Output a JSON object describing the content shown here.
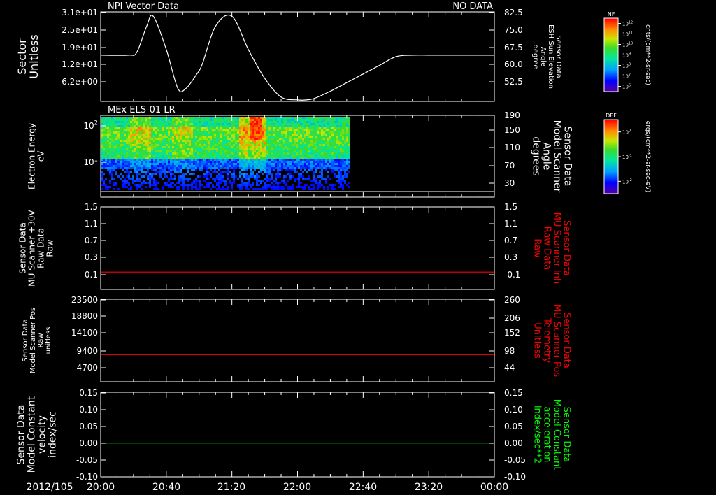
{
  "date_label": "2012/105",
  "time_ticks": [
    "20:00",
    "20:40",
    "21:20",
    "22:00",
    "22:40",
    "23:20",
    "00:00"
  ],
  "colorbars": [
    {
      "title": "NF",
      "unit": "cnts/(cm**2-sr-sec)",
      "ticks": [
        "10^12",
        "10^11",
        "10^10",
        "10^9",
        "10^8",
        "10^7",
        "10^6"
      ]
    },
    {
      "title": "DEF",
      "unit": "ergs/(cm**2-sr-sec-eV)",
      "ticks": [
        "10^0",
        "10^-1",
        "10^-2"
      ]
    }
  ],
  "chart_data": [
    {
      "type": "line",
      "title": "NPI Vector Data",
      "status": "NO DATA",
      "ylabel": [
        "Sector",
        "Unitless"
      ],
      "ylabel_right": [
        "Sensor Data",
        "ESH Sun Elevation",
        "Angle",
        "degree"
      ],
      "yticks": [
        "3.1e+01",
        "2.5e+01",
        "1.9e+01",
        "1.2e+01",
        "6.2e+00"
      ],
      "yticks_right": [
        "82.5",
        "75.0",
        "67.5",
        "60.0",
        "52.5"
      ],
      "ylim": [
        0,
        31
      ],
      "line_color": "#ffffff",
      "series": [
        {
          "x_minutes": [
            0,
            17,
            22,
            28,
            32,
            40,
            47,
            52,
            58,
            62,
            70,
            80,
            90,
            100,
            110,
            120,
            125,
            130,
            140,
            150,
            160,
            170,
            180,
            190,
            200,
            210,
            220,
            230,
            240
          ],
          "values": [
            16,
            16,
            17,
            26,
            29.5,
            18,
            4.5,
            4.5,
            9,
            13,
            26,
            29.5,
            18,
            8,
            1.5,
            0.5,
            0.5,
            1.0,
            3.5,
            6.5,
            9.5,
            12.5,
            15.5,
            16,
            16,
            16,
            16,
            16,
            16
          ]
        }
      ]
    },
    {
      "type": "heatmap",
      "title": "MEx ELS-01 LR",
      "ylabel": [
        "Electron Energy",
        "eV"
      ],
      "ylabel_right": [
        "Sensor Data",
        "Model Scanner",
        "Angle",
        "degrees"
      ],
      "yticks": [
        "10^2",
        "10^1"
      ],
      "yticks_right": [
        "190",
        "150",
        "110",
        "70",
        "30"
      ],
      "data_extent_minutes": [
        0,
        152
      ],
      "colormap": "rainbow",
      "scanner_line_value": 10
    },
    {
      "type": "line",
      "ylabel": [
        "Sensor Data",
        "MU Scanner +30V",
        "Raw Data",
        "Raw"
      ],
      "ylabel_right": [
        "Sensor Data",
        "MU Scanner Inh",
        "Raw Data",
        "Raw"
      ],
      "yticks": [
        "1.5",
        "1.1",
        "0.7",
        "0.3",
        "-0.1"
      ],
      "yticks_right": [
        "1.5",
        "1.1",
        "0.7",
        "0.3",
        "-0.1"
      ],
      "ylim": [
        -0.4,
        1.5
      ],
      "line_color": "#ff0000",
      "right_label_color": "#ff0000",
      "series": [
        {
          "x_minutes": [
            0,
            240
          ],
          "values": [
            0,
            0
          ]
        }
      ]
    },
    {
      "type": "line",
      "ylabel": [
        "Sensor Data",
        "Model Scanner Pos",
        "Raw",
        "unitless"
      ],
      "ylabel_right": [
        "Sensor Data",
        "MU Scanner Pos",
        "Telemetry",
        "Unitless"
      ],
      "yticks": [
        "23500",
        "18800",
        "14100",
        "9400",
        "4700"
      ],
      "yticks_right": [
        "260",
        "206",
        "152",
        "98",
        "44"
      ],
      "ylim": [
        0,
        23500
      ],
      "line_color": "#ff0000",
      "right_label_color": "#ff0000",
      "series": [
        {
          "x_minutes": [
            0,
            240
          ],
          "values": [
            7700,
            7700
          ]
        }
      ]
    },
    {
      "type": "line",
      "ylabel": [
        "Sensor Data",
        "Model Constant",
        "velocity",
        "index/sec"
      ],
      "ylabel_right": [
        "Sensor Data",
        "Model Constant",
        "acceleration",
        "index/sec**2"
      ],
      "yticks": [
        "0.15",
        "0.10",
        "0.05",
        "0.00",
        "-0.05",
        "-0.10"
      ],
      "yticks_right": [
        "0.15",
        "0.10",
        "0.05",
        "0.00",
        "-0.05",
        "-0.10"
      ],
      "ylim": [
        -0.1,
        0.15
      ],
      "line_color": "#00ff00",
      "right_label_color": "#00ff00",
      "series": [
        {
          "x_minutes": [
            0,
            240
          ],
          "values": [
            0,
            0
          ]
        }
      ]
    }
  ]
}
